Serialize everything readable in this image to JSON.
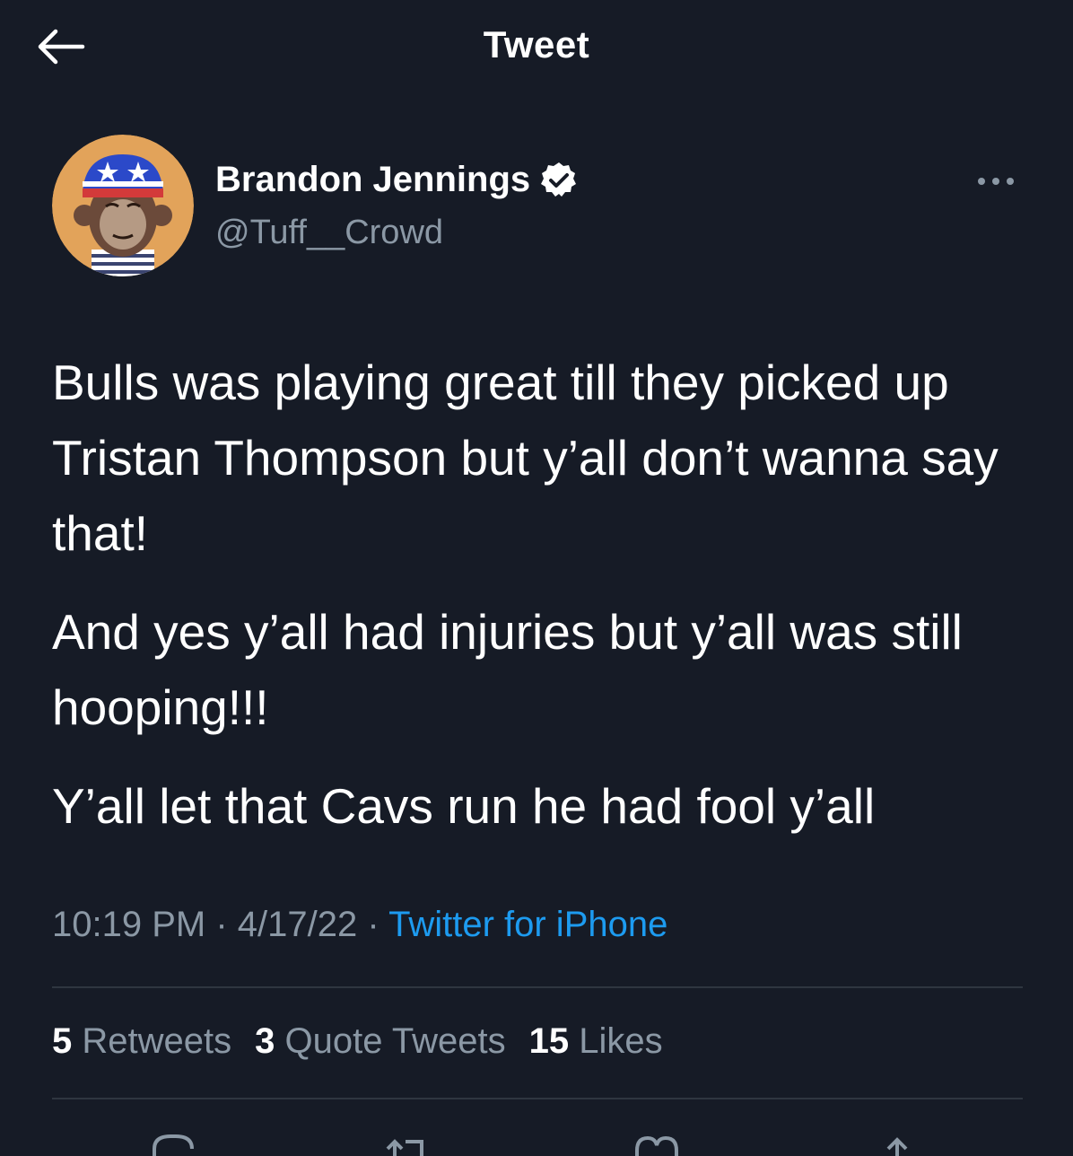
{
  "header": {
    "title": "Tweet",
    "back_icon": "arrow-left-icon"
  },
  "author": {
    "display_name": "Brandon Jennings",
    "handle": "@Tuff__Crowd",
    "verified": true,
    "avatar_icon": "ape-avatar-with-flag-helmet",
    "more_icon": "more-horizontal-icon"
  },
  "tweet": {
    "paragraphs": [
      "Bulls was playing great till they picked up Tristan Thompson but y’all don’t wanna say that!",
      "And yes y’all had injuries but y’all was still hooping!!!",
      "Y’all let that Cavs run he had fool y’all"
    ],
    "time": "10:19 PM",
    "separator": "·",
    "date": "4/17/22",
    "source": "Twitter for iPhone"
  },
  "stats": {
    "retweets_count": "5",
    "retweets_label": "Retweets",
    "quotes_count": "3",
    "quotes_label": "Quote Tweets",
    "likes_count": "15",
    "likes_label": "Likes"
  },
  "actions": [
    "reply-icon",
    "retweet-icon",
    "like-icon",
    "share-icon"
  ],
  "colors": {
    "background": "#161b26",
    "text": "#ffffff",
    "secondary": "#8b98a5",
    "link": "#1d9bf0",
    "divider": "#2f3640"
  }
}
